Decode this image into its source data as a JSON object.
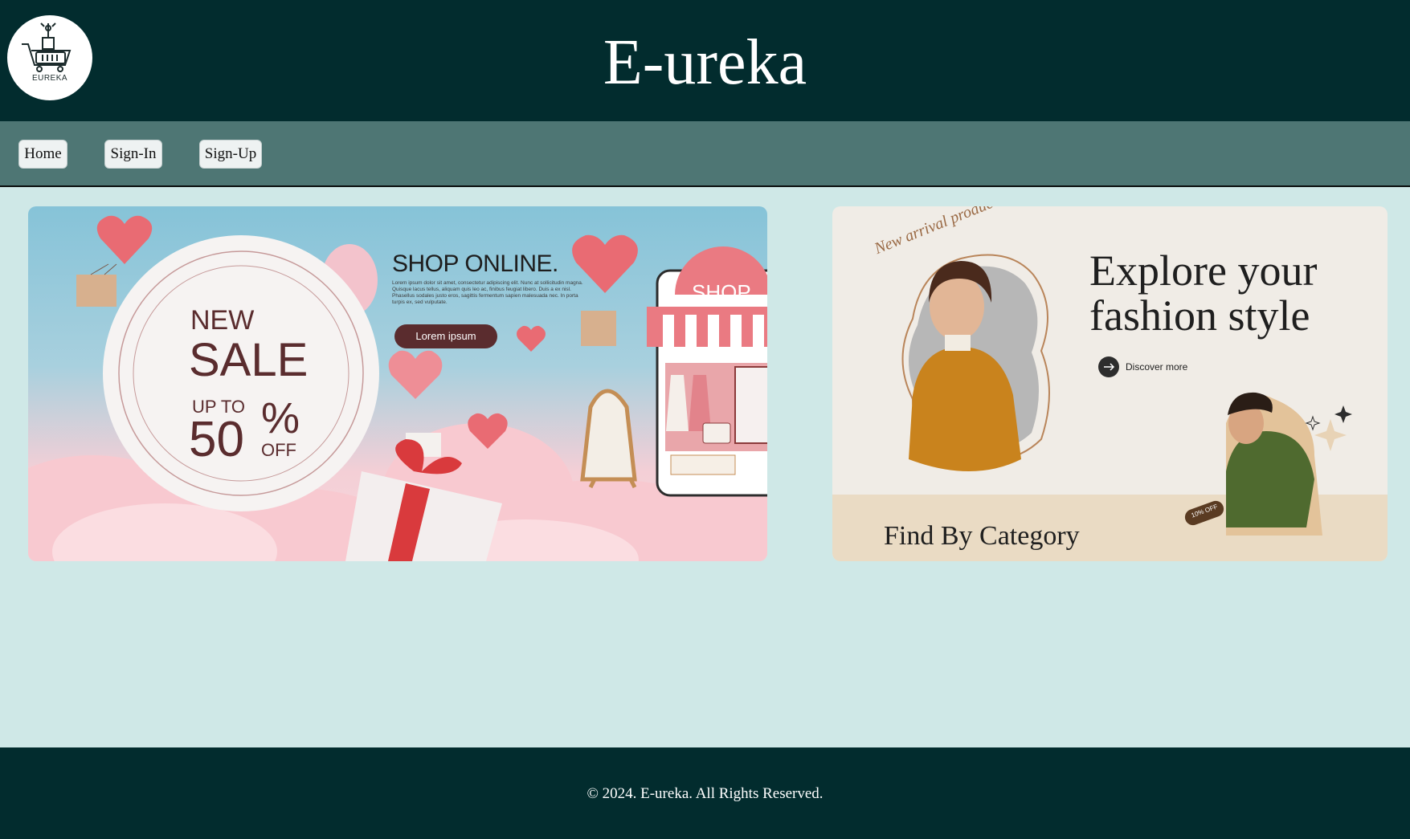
{
  "header": {
    "logo_text": "EUREKA",
    "title": "E-ureka"
  },
  "nav": {
    "items": [
      {
        "label": "Home"
      },
      {
        "label": "Sign-In"
      },
      {
        "label": "Sign-Up"
      }
    ]
  },
  "banners": {
    "left": {
      "heading": "SHOP ONLINE.",
      "body_text": "Lorem ipsum dolor sit amet, consectetur adipiscing elit. Nunc at sollicitudin magna. Quisque lacus tellus, aliquam quis leo ac, finibus feugiat libero. Duis a ex nisl. Phasellus sodales justo eros, sagittis fermentum sapien malesuada nec. In porta turpis ex, sed vulputate.",
      "button_label": "Lorem ipsum",
      "sale_new": "NEW",
      "sale_word": "SALE",
      "sale_upto": "UP TO",
      "sale_number": "50",
      "sale_percent": "%",
      "sale_off": "OFF",
      "shop_sign": "SHOP"
    },
    "right": {
      "arc_text": "New arrival product",
      "heading_line1": "Explore your",
      "heading_line2": "fashion style",
      "discover_label": "Discover more",
      "discount_tag": "10% OFF",
      "category_label": "Find By Category"
    }
  },
  "footer": {
    "text": "© 2024. E-ureka. All Rights Reserved."
  },
  "colors": {
    "header_bg": "#022c2e",
    "nav_bg": "#4e7674",
    "page_bg": "#cfe8e7",
    "footer_bg": "#022c2e"
  }
}
